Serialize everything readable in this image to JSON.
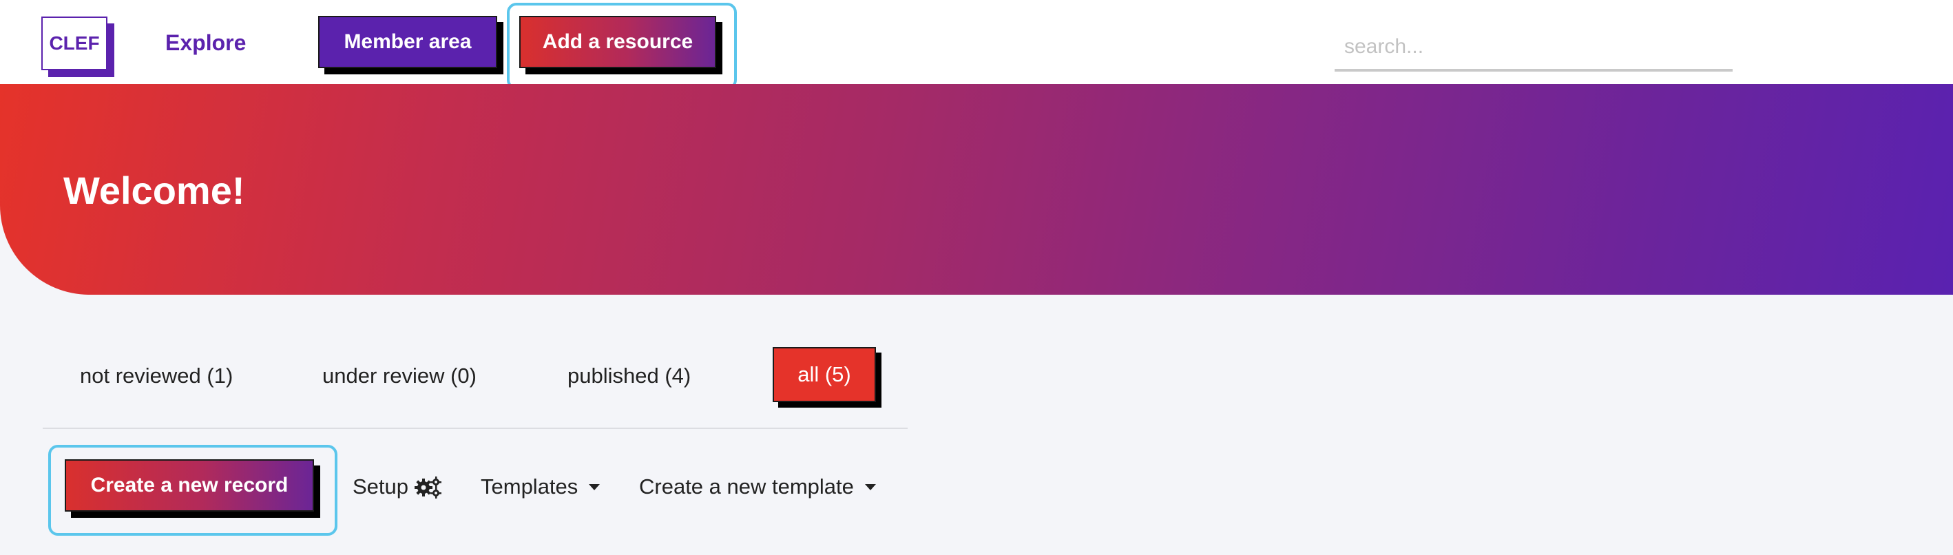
{
  "header": {
    "logo_text": "CLEF",
    "nav_explore": "Explore",
    "member_button": "Member area",
    "add_resource_button": "Add a resource",
    "search_placeholder": "search..."
  },
  "hero": {
    "title": "Welcome!"
  },
  "tabs": [
    {
      "label": "not reviewed (1)",
      "active": false
    },
    {
      "label": "under review (0)",
      "active": false
    },
    {
      "label": "published (4)",
      "active": false
    },
    {
      "label": "all (5)",
      "active": true
    }
  ],
  "toolbar": {
    "create_record_button": "Create a new record",
    "setup_label": "Setup",
    "templates_label": "Templates",
    "new_template_label": "Create a new template"
  },
  "icons": {
    "setup": "gears-icon",
    "dropdown": "caret-down-icon"
  },
  "colors": {
    "brand_purple": "#5b22ad",
    "brand_red": "#e5332a",
    "focus_ring": "#5bc6ec"
  }
}
